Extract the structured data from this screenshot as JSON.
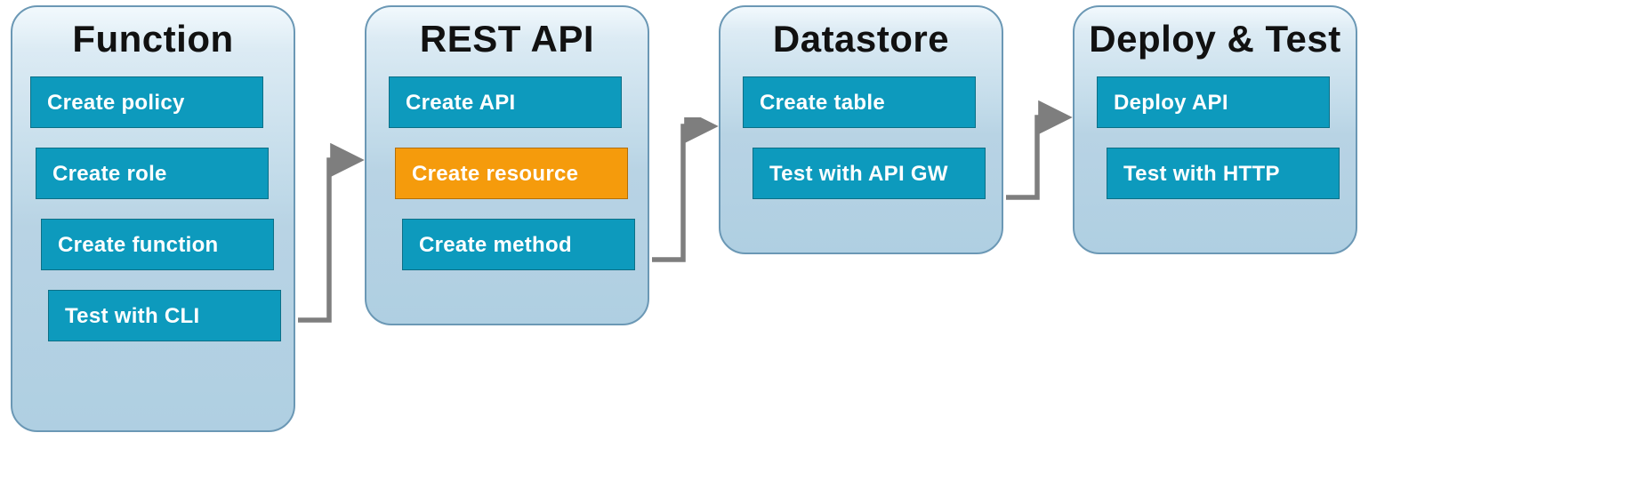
{
  "diagram": {
    "stages": [
      {
        "title": "Function",
        "steps": [
          {
            "label": "Create policy",
            "highlight": false
          },
          {
            "label": "Create role",
            "highlight": false
          },
          {
            "label": "Create function",
            "highlight": false
          },
          {
            "label": "Test with CLI",
            "highlight": false
          }
        ]
      },
      {
        "title": "REST API",
        "steps": [
          {
            "label": "Create API",
            "highlight": false
          },
          {
            "label": "Create resource",
            "highlight": true
          },
          {
            "label": "Create method",
            "highlight": false
          }
        ]
      },
      {
        "title": "Datastore",
        "steps": [
          {
            "label": "Create table",
            "highlight": false
          },
          {
            "label": "Test with API GW",
            "highlight": false
          }
        ]
      },
      {
        "title": "Deploy & Test",
        "steps": [
          {
            "label": "Deploy API",
            "highlight": false
          },
          {
            "label": "Test with HTTP",
            "highlight": false
          }
        ]
      }
    ],
    "colors": {
      "stepDefault": "#0d9abd",
      "stepHighlight": "#f59b0c",
      "arrow": "#7e7e7e",
      "panelBorder": "#6b98b5"
    }
  }
}
